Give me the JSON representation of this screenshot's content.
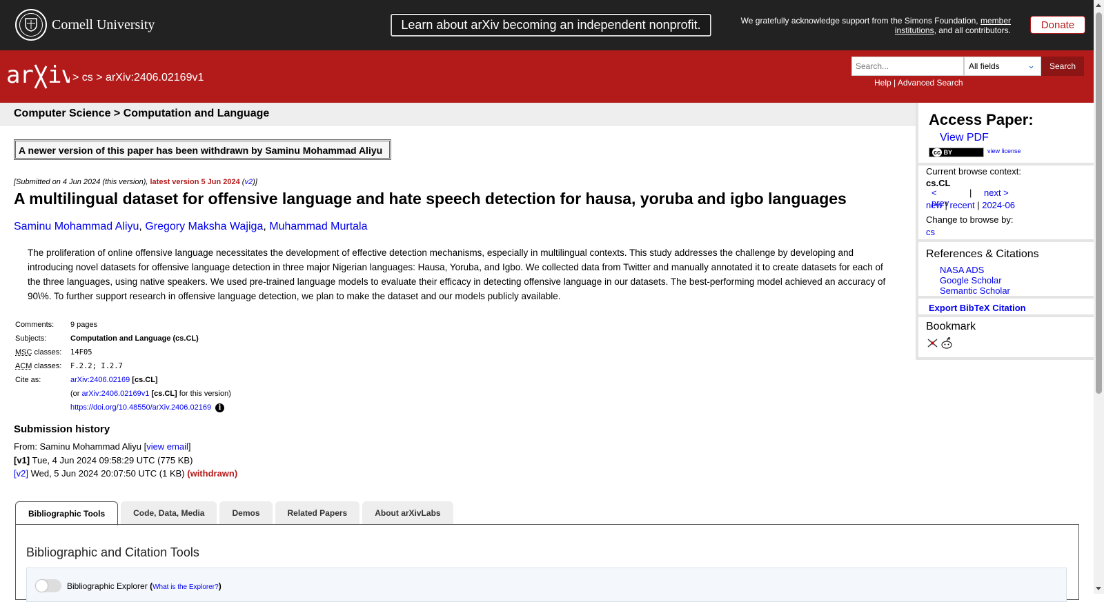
{
  "topbar": {
    "cornell_name": "Cornell University",
    "announcement": "Learn about arXiv becoming an independent nonprofit.",
    "support_text": "We gratefully acknowledge support from the Simons Foundation,",
    "support_link": "member institutions",
    "support_tail": ", and all contributors.",
    "donate_label": "Donate"
  },
  "header": {
    "logo_text": "arXiv",
    "crumb_sep1": ">",
    "crumb_cs": "cs",
    "crumb_sep2": ">",
    "crumb_id": "arXiv:2406.02169v1",
    "search_placeholder": "Search...",
    "field_select_value": "All fields",
    "search_button": "Search",
    "help_link": "Help",
    "link_sep": "|",
    "advanced_link": "Advanced Search"
  },
  "subject_bar": "Computer Science > Computation and Language",
  "paper": {
    "withdrawn_notice": "A newer version of this paper has been withdrawn by Saminu Mohammad Aliyu",
    "submitted_prefix": "[Submitted on 4 Jun 2024 (this version), ",
    "latest_version": "latest version 5 Jun 2024",
    "v2_link": "v2",
    "title": "A multilingual dataset for offensive language and hate speech detection for hausa, yoruba and igbo languages",
    "authors": [
      "Saminu Mohammad Aliyu",
      "Gregory Maksha Wajiga",
      "Muhammad Murtala"
    ],
    "abstract": "The proliferation of online offensive language necessitates the development of effective detection mechanisms, especially in multilingual contexts. This study addresses the challenge by developing and introducing novel datasets for offensive language detection in three major Nigerian languages: Hausa, Yoruba, and Igbo. We collected data from Twitter and manually annotated it to create datasets for each of the three languages, using native speakers. We used pre-trained language models to evaluate their efficacy in detecting offensive language in our datasets. The best-performing model achieved an accuracy of 90\\%. To further support research in offensive language detection, we plan to make the dataset and our models publicly available.",
    "meta": {
      "comments_label": "Comments:",
      "comments": "9 pages",
      "subjects_label": "Subjects:",
      "subjects": "Computation and Language (cs.CL)",
      "msc_abbr": "MSC",
      "msc_label": " classes:",
      "msc": "14F05",
      "acm_abbr": "ACM",
      "acm_label": " classes:",
      "acm": "F.2.2; I.2.7",
      "cite_label": "Cite as:",
      "cite_id": "arXiv:2406.02169",
      "cite_cat": "[cs.CL]",
      "cite_or": "(or ",
      "cite_version_id": "arXiv:2406.02169v1",
      "cite_version_cat": "[cs.CL]",
      "cite_version_tail": " for this version)",
      "doi": "https://doi.org/10.48550/arXiv.2406.02169"
    },
    "history": {
      "heading": "Submission history",
      "from": "From: Saminu Mohammad Aliyu [",
      "view_email": "view email",
      "v1_label": "[v1]",
      "v1_text": " Tue, 4 Jun 2024 09:58:29 UTC (775 KB)",
      "v2_label": "[v2]",
      "v2_text": " Wed, 5 Jun 2024 20:07:50 UTC (1 KB) ",
      "v2_status": "(withdrawn)"
    }
  },
  "tabs": [
    "Bibliographic Tools",
    "Code, Data, Media",
    "Demos",
    "Related Papers",
    "About arXivLabs"
  ],
  "panel": {
    "title": "Bibliographic and Citation Tools",
    "explorer_label": "Bibliographic Explorer",
    "explorer_link": "What is the Explorer?"
  },
  "sidebar": {
    "access_heading": "Access Paper:",
    "view_pdf": "View PDF",
    "license_badge": "BY",
    "view_license": "view license",
    "context_label": "Current browse context:",
    "context_value": "cs.CL",
    "prev": "< prev",
    "bar": "|",
    "next": "next >",
    "new": "new",
    "recent": "recent",
    "month": "2024-06",
    "change_label": "Change to browse by:",
    "change_value": "cs",
    "refs_heading": "References & Citations",
    "refs": [
      "NASA ADS",
      "Google Scholar",
      "Semantic Scholar"
    ],
    "bibtex": "Export BibTeX Citation",
    "bookmark_heading": "Bookmark",
    "bookmark_icons": [
      "bibsonomy-icon",
      "reddit-icon"
    ]
  }
}
